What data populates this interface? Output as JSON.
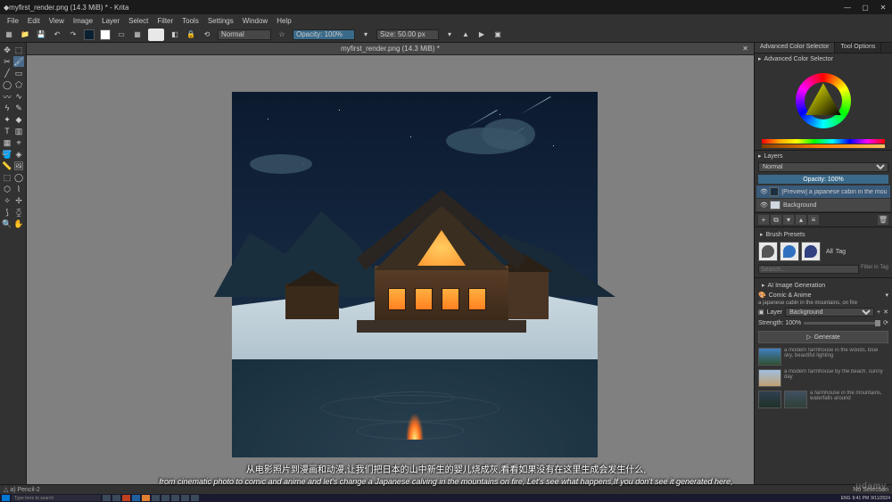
{
  "app": {
    "name": "Krita",
    "title": "myfirst_render.png (14.3 MiB) * - Krita"
  },
  "window_controls": {
    "min": "—",
    "max": "▢",
    "close": "✕"
  },
  "menu": [
    "File",
    "Edit",
    "View",
    "Image",
    "Layer",
    "Select",
    "Filter",
    "Tools",
    "Settings",
    "Window",
    "Help"
  ],
  "toolbar": {
    "blend_mode": "Normal",
    "opacity_label": "Opacity: 100%",
    "size_label": "Size: 50.00 px"
  },
  "document": {
    "tab": "myfirst_render.png (14.3 MiB) *"
  },
  "right": {
    "tabs": [
      "Advanced Color Selector",
      "Tool Options"
    ],
    "color_title": "Advanced Color Selector",
    "layers": {
      "title": "Layers",
      "blend": "Normal",
      "opacity": "Opacity: 100%",
      "items": [
        {
          "name": "[Preview] a japanese cabin in the mountains…"
        },
        {
          "name": "Background"
        }
      ]
    },
    "brush": {
      "title": "Brush Presets",
      "all": "All",
      "tag": "Tag",
      "search_ph": "Search…",
      "filter": "Filter in Tag"
    },
    "ai": {
      "title": "AI Image Generation",
      "style_label": "Comic & Anime",
      "prompt": "a japanese cabin in the mountains, on fire",
      "layer_label": "Layer",
      "layer_value": "Background",
      "strength_label": "Strength: 100%",
      "refresh": "⟳",
      "generate": "Generate",
      "history": [
        "a modern farmhouse in the woods, blue sky, beautiful lighting",
        "a modern farmhouse by the beach, sunny day",
        "a farmhouse in the mountains, waterfalls around"
      ]
    }
  },
  "status": {
    "left": "△  a) Pencil-2",
    "selection": "No Selection"
  },
  "subtitles": {
    "cn": "从电影照片到漫画和动漫,让我们把日本的山中新生的婴儿烧成灰,看看如果没有在这里生成会发生什么,",
    "en": "from cinematic photo to comic and anime and let's change a Japanese calving in the mountains on fire, Let's see what happens,If you don't see it generated here,"
  },
  "taskbar": {
    "search_ph": "Type here to search",
    "time": "9:41 PM",
    "date": "9/11/2024",
    "lang": "ENG"
  },
  "watermark": "udemy"
}
